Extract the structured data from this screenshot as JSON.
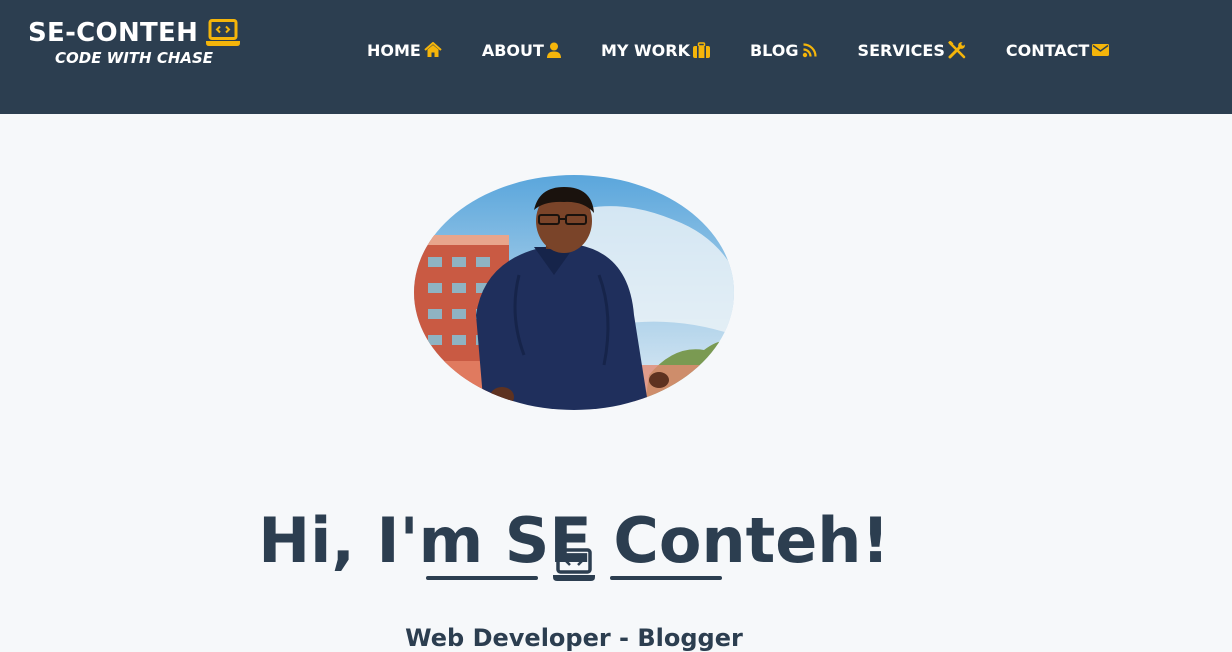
{
  "brand": {
    "title": "SE-CONTEH",
    "subtitle": "CODE WITH CHASE",
    "icon": "laptop-code-icon"
  },
  "nav": {
    "items": [
      {
        "label": "HOME",
        "icon": "home-icon"
      },
      {
        "label": "ABOUT",
        "icon": "user-icon"
      },
      {
        "label": "MY WORK",
        "icon": "briefcase-icon"
      },
      {
        "label": "BLOG",
        "icon": "rss-icon"
      },
      {
        "label": "SERVICES",
        "icon": "tools-icon"
      },
      {
        "label": "CONTACT",
        "icon": "envelope-icon"
      }
    ]
  },
  "hero": {
    "title": "Hi, I'm SE Conteh!",
    "divider_icon": "laptop-code-icon",
    "subtitle": "Web Developer - Blogger"
  },
  "colors": {
    "navbar": "#2c3e50",
    "accent": "#f5b50a",
    "text_dark": "#2c3e50",
    "background": "#f6f8fa"
  }
}
